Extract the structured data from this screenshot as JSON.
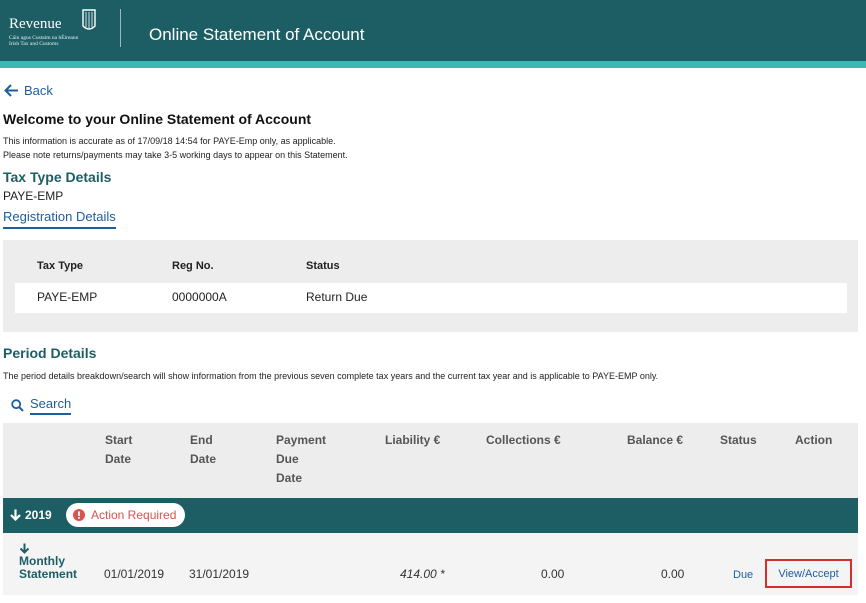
{
  "header": {
    "logo_word": "Revenue",
    "logo_sub_1": "Cáin agus Custaim na hÉireann",
    "logo_sub_2": "Irish Tax and Customs",
    "title": "Online Statement of Account",
    "bg_color": "#1d5e64",
    "stripe_color": "#3fb8b4"
  },
  "nav": {
    "back_label": "Back"
  },
  "welcome": {
    "title": "Welcome to your Online Statement of Account",
    "info_line1": "This information is accurate as of 17/09/18 14:54 for PAYE-Emp only, as applicable.",
    "info_line2": "Please note returns/payments may take 3-5 working days to appear on this Statement."
  },
  "tax_type": {
    "heading": "Tax Type Details",
    "value": "PAYE-EMP",
    "registration_link": "Registration Details",
    "table": {
      "headers": {
        "tax_type": "Tax Type",
        "reg_no": "Reg No.",
        "status": "Status"
      },
      "row": {
        "tax_type": "PAYE-EMP",
        "reg_no": "0000000A",
        "status": "Return Due"
      }
    }
  },
  "period": {
    "heading": "Period Details",
    "info": "The period details breakdown/search will show information from the previous seven complete tax years and the current tax year and is applicable to PAYE-EMP only.",
    "search_label": "Search",
    "columns": {
      "start_1": "Start",
      "start_2": "Date",
      "end_1": "End",
      "end_2": "Date",
      "pay_1": "Payment",
      "pay_2": "Due",
      "pay_3": "Date",
      "liability": "Liability €",
      "collections": "Collections €",
      "balance": "Balance €",
      "status": "Status",
      "action": "Action"
    },
    "year_group": {
      "year": "2019",
      "badge": "Action Required",
      "badge_color": "#d9534f"
    },
    "row": {
      "title_1": "Monthly",
      "title_2": "Statement",
      "start_date": "01/01/2019",
      "end_date": "31/01/2019",
      "liability": "414.00 *",
      "collections": "0.00",
      "balance": "0.00",
      "status": "Due",
      "action": "View/Accept"
    }
  },
  "colors": {
    "link": "#1d5e9c",
    "heading_teal": "#1d5e64",
    "highlight_border": "#d32f2f"
  }
}
